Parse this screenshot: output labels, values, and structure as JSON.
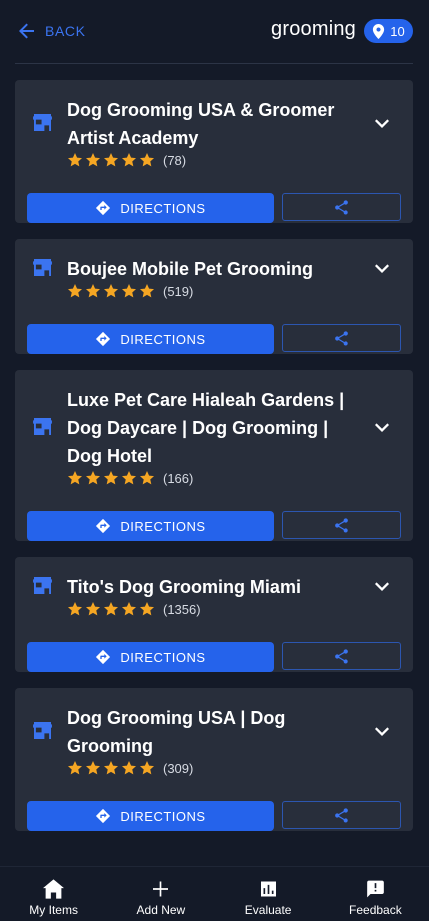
{
  "header": {
    "back_label": "BACK",
    "search_term": "grooming",
    "result_count": "10"
  },
  "listings": [
    {
      "name_lines": [
        "Dog Grooming USA & Groomer",
        "Artist Academy"
      ],
      "rating": 5,
      "reviews": "(78)",
      "directions_label": "DIRECTIONS"
    },
    {
      "name_lines": [
        "Boujee Mobile Pet Grooming"
      ],
      "rating": 5,
      "reviews": "(519)",
      "directions_label": "DIRECTIONS"
    },
    {
      "name_lines": [
        "Luxe Pet Care Hialeah Gardens |",
        "Dog Daycare | Dog Grooming |",
        "Dog Hotel"
      ],
      "rating": 5,
      "reviews": "(166)",
      "directions_label": "DIRECTIONS"
    },
    {
      "name_lines": [
        "Tito's Dog Grooming Miami"
      ],
      "rating": 5,
      "reviews": "(1356)",
      "directions_label": "DIRECTIONS"
    },
    {
      "name_lines": [
        "Dog Grooming USA | Dog",
        "Grooming"
      ],
      "rating": 5,
      "reviews": "(309)",
      "directions_label": "DIRECTIONS"
    }
  ],
  "bottom_nav": [
    {
      "label": "My Items",
      "icon": "home-icon"
    },
    {
      "label": "Add New",
      "icon": "plus-icon"
    },
    {
      "label": "Evaluate",
      "icon": "bar-chart-icon"
    },
    {
      "label": "Feedback",
      "icon": "feedback-icon"
    }
  ],
  "colors": {
    "background": "#141a28",
    "card": "#282e3b",
    "accent": "#2563eb",
    "star": "#f5a623"
  }
}
